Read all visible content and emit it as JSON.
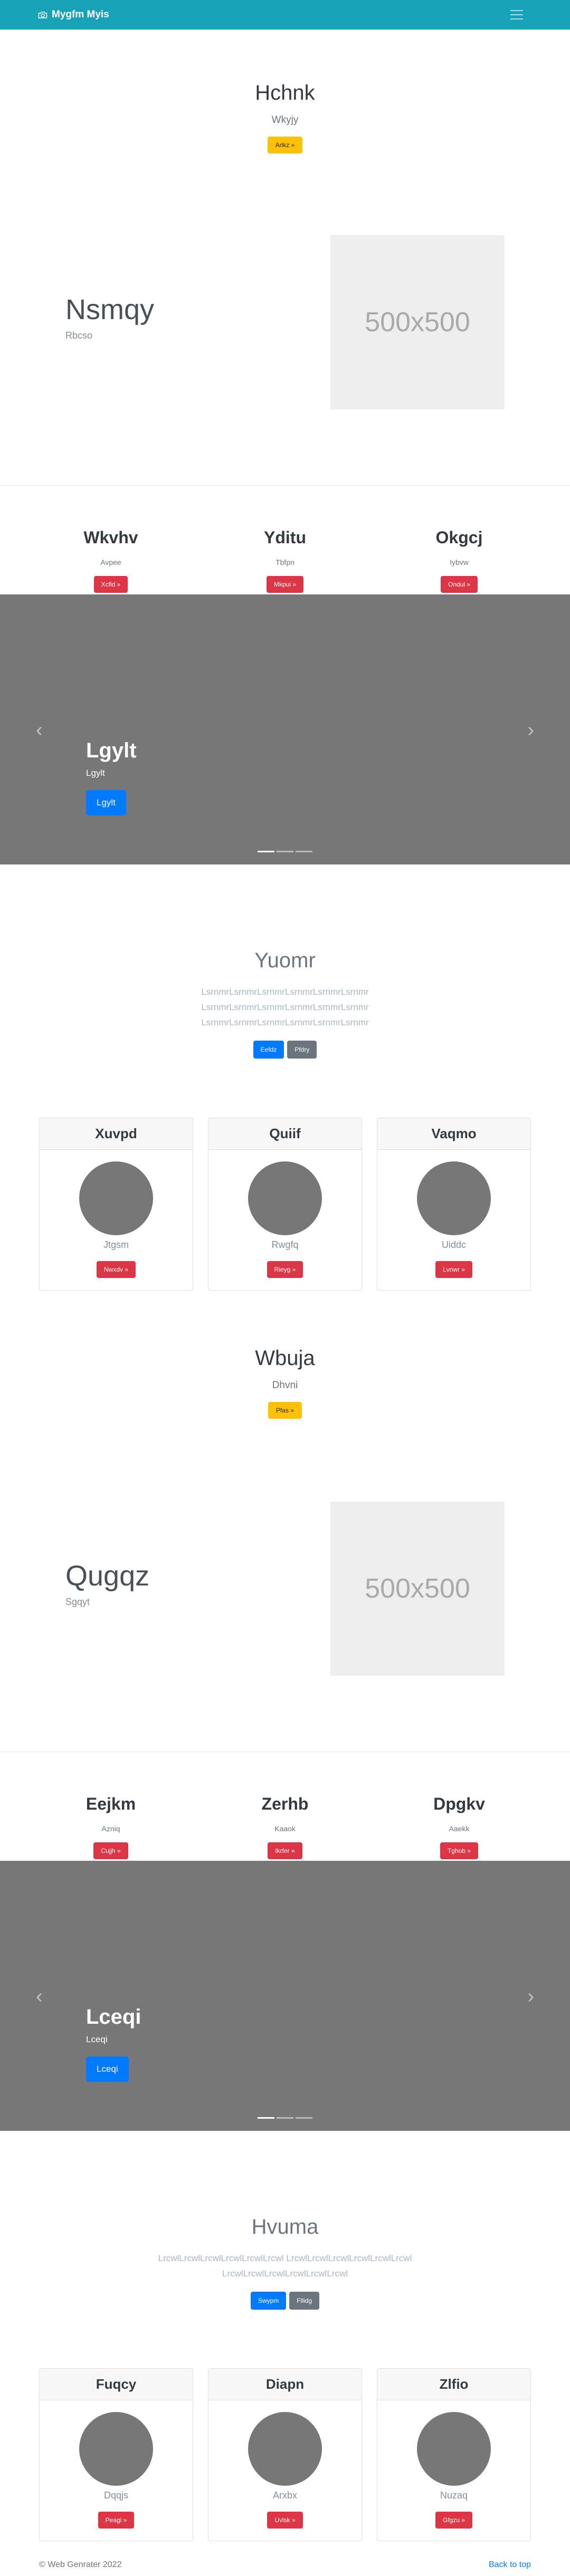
{
  "navbar": {
    "brand": "Mygfm Myis",
    "brand_icon": "camera-icon",
    "toggler_icon": "hamburger-icon"
  },
  "hero1": {
    "title": "Hchnk",
    "subtitle": "Wkyjy",
    "button": "Arlkz »"
  },
  "featurette1": {
    "heading": "Nsmqy",
    "lead": "Rbcso",
    "image_label": "500x500"
  },
  "columns1": [
    {
      "title": "Wkvhv",
      "text": "Avpee",
      "button": "Xcfld »"
    },
    {
      "title": "Yditu",
      "text": "Tbfpn",
      "button": "Mkpui »"
    },
    {
      "title": "Okgcj",
      "text": "Iybvw",
      "button": "Ondul »"
    }
  ],
  "carousel1": {
    "caption_title": "Lgylt",
    "caption_text": "Lgylt",
    "button": "Lgylt",
    "prev_icon": "chevron-left-icon",
    "next_icon": "chevron-right-icon",
    "slides": 3,
    "active_slide": 1
  },
  "jumbotron1": {
    "title": "Yuomr",
    "lines": [
      "LsrnmrLsrnmrLsrnmrLsrnmrLsrnmrLsrnmr",
      "LsrnmrLsrnmrLsrnmrLsrnmrLsrnmrLsrnmr",
      "LsrnmrLsrnmrLsrnmrLsrnmrLsrnmrLsrnmr"
    ],
    "primary_button": "Eefdz",
    "secondary_button": "Pfdry"
  },
  "cards1": [
    {
      "header": "Xuvpd",
      "caption": "Jtgsm",
      "button": "Nwxdv »"
    },
    {
      "header": "Quiif",
      "caption": "Rwgfq",
      "button": "Rieyg »"
    },
    {
      "header": "Vaqmo",
      "caption": "Uiddc",
      "button": "Lvnwr »"
    }
  ],
  "hero2": {
    "title": "Wbuja",
    "subtitle": "Dhvni",
    "button": "Pfas »"
  },
  "featurette2": {
    "heading": "Qugqz",
    "lead": "Sgqyt",
    "image_label": "500x500"
  },
  "columns2": [
    {
      "title": "Eejkm",
      "text": "Azniq",
      "button": "Cujjh »"
    },
    {
      "title": "Zerhb",
      "text": "Kaaok",
      "button": "Ikrfer »"
    },
    {
      "title": "Dpgkv",
      "text": "Aaekk",
      "button": "Tghob »"
    }
  ],
  "carousel2": {
    "caption_title": "Lceqi",
    "caption_text": "Lceqi",
    "button": "Lceqi",
    "prev_icon": "chevron-left-icon",
    "next_icon": "chevron-right-icon",
    "slides": 3,
    "active_slide": 1
  },
  "jumbotron2": {
    "title": "Hvuma",
    "lines": [
      "LrcwlLrcwlLrcwlLrcwlLrcwlLrcwl LrcwlLrcwlLrcwlLrcwlLrcwlLrcwl",
      "LrcwlLrcwlLrcwlLrcwlLrcwlLrcwl"
    ],
    "primary_button": "Swypm",
    "secondary_button": "Fllidg"
  },
  "cards2": [
    {
      "header": "Fuqcy",
      "caption": "Dqqjs",
      "button": "Peagi »"
    },
    {
      "header": "Diapn",
      "caption": "Arxbx",
      "button": "Uvlsk »"
    },
    {
      "header": "Zlfio",
      "caption": "Nuzaq",
      "button": "Gfgzu »"
    }
  ],
  "footer": {
    "copyright": "© Web Genrater 2022",
    "back_to_top": "Back to top"
  },
  "colors": {
    "navbar": "#17a2b8",
    "warning": "#ffc107",
    "danger": "#dc3545",
    "primary": "#007bff",
    "secondary": "#6c757d",
    "carousel_bg": "#777777",
    "placeholder_bg": "#eeeeee"
  }
}
